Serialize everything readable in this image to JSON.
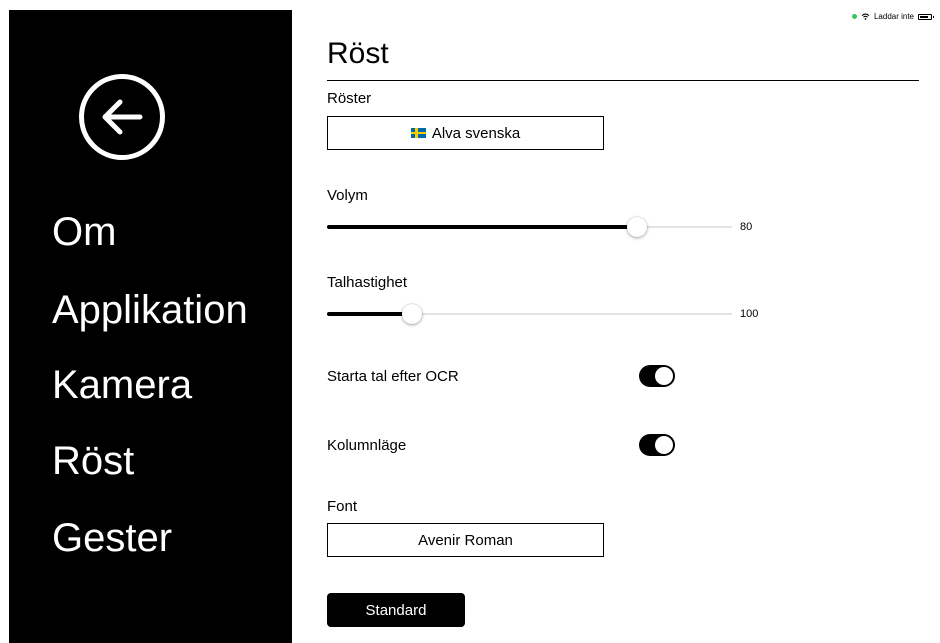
{
  "status_bar": {
    "charging_text": "Laddar inte",
    "indicator_color": "#34c759"
  },
  "sidebar": {
    "back_icon": "arrow-left-circle-icon",
    "items": [
      {
        "label": "Om"
      },
      {
        "label": "Applikation"
      },
      {
        "label": "Kamera"
      },
      {
        "label": "Röst"
      },
      {
        "label": "Gester"
      }
    ],
    "background": "#000000",
    "text_color": "#ffffff"
  },
  "main": {
    "title": "Röst",
    "voices": {
      "label": "Röster",
      "selected": "Alva svenska",
      "flag_icon": "swedish-flag-icon"
    },
    "volume": {
      "label": "Volym",
      "value": "80",
      "fraction": 0.765
    },
    "speech_rate": {
      "label": "Talhastighet",
      "value": "100",
      "fraction": 0.21
    },
    "start_speech_after_ocr": {
      "label": "Starta tal efter OCR",
      "on": true
    },
    "column_mode": {
      "label": "Kolumnläge",
      "on": true
    },
    "font": {
      "label": "Font",
      "selected": "Avenir Roman"
    },
    "default_button": "Standard"
  }
}
